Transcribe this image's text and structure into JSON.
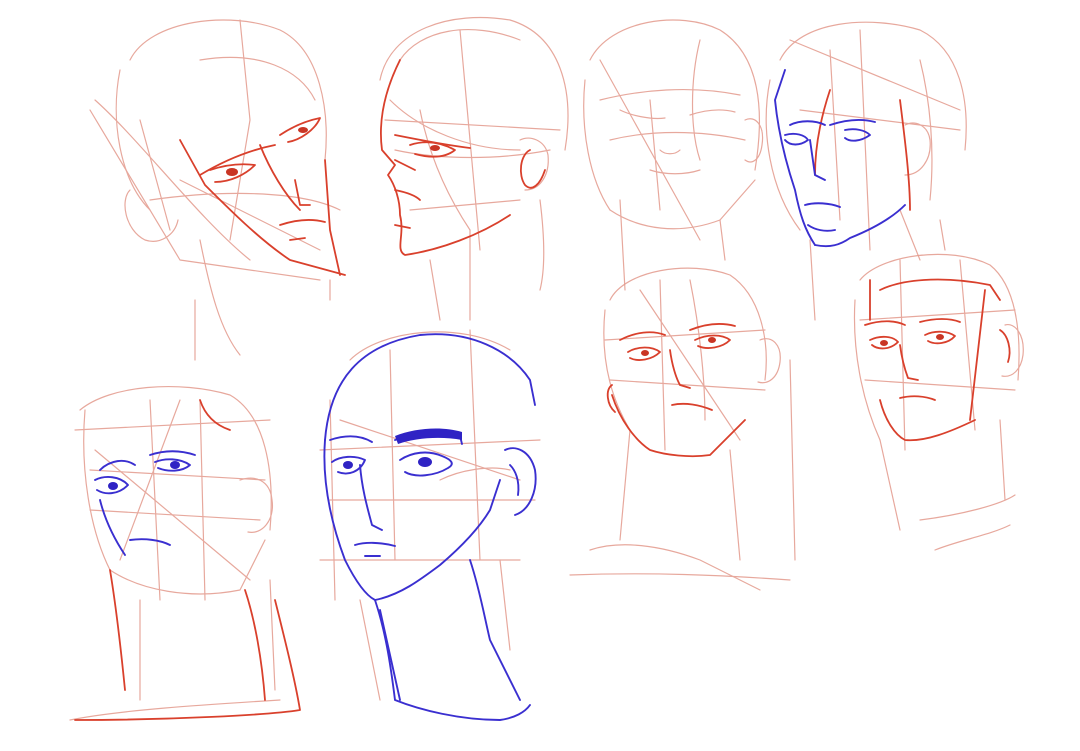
{
  "canvas": {
    "background": "#ffffff"
  },
  "colors": {
    "sketch_light": "#e39a8c",
    "sketch_red": "#d9402c",
    "ink_blue": "#3a2fd0"
  },
  "sheet": {
    "subject": "head-study-sketches",
    "heads": [
      {
        "id": "head-1",
        "view": "three-quarter-down",
        "ink": "red"
      },
      {
        "id": "head-2",
        "view": "profile-left",
        "ink": "red"
      },
      {
        "id": "head-3",
        "view": "looking-up",
        "ink": "light"
      },
      {
        "id": "head-4",
        "view": "three-quarter-left",
        "ink": "red-blue"
      },
      {
        "id": "head-5",
        "view": "looking-up-low",
        "ink": "red-blue"
      },
      {
        "id": "head-6",
        "view": "three-quarter-left",
        "ink": "blue"
      },
      {
        "id": "head-7",
        "view": "tilted-down",
        "ink": "red"
      },
      {
        "id": "head-8",
        "view": "three-quarter-left",
        "ink": "red"
      }
    ]
  }
}
